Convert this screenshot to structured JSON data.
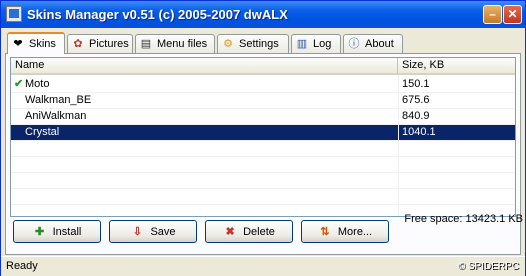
{
  "window": {
    "title": "Skins Manager v0.51 (c) 2005-2007 dwALX"
  },
  "tabs": [
    {
      "label": "Skins"
    },
    {
      "label": "Pictures"
    },
    {
      "label": "Menu files"
    },
    {
      "label": "Settings"
    },
    {
      "label": "Log"
    },
    {
      "label": "About"
    }
  ],
  "list": {
    "columns": [
      "Name",
      "Size, KB"
    ],
    "rows": [
      {
        "name": "Moto",
        "size": "150.1"
      },
      {
        "name": "Walkman_BE",
        "size": "675.6"
      },
      {
        "name": "AniWalkman",
        "size": "840.9"
      },
      {
        "name": "Crystal",
        "size": "1040.1"
      }
    ]
  },
  "buttons": {
    "install": "Install",
    "save": "Save",
    "delete": "Delete",
    "more": "More..."
  },
  "free_space": "Free space: 13423.1 KB",
  "status": {
    "text": "Ready",
    "brand": "© SPIDERPC"
  }
}
